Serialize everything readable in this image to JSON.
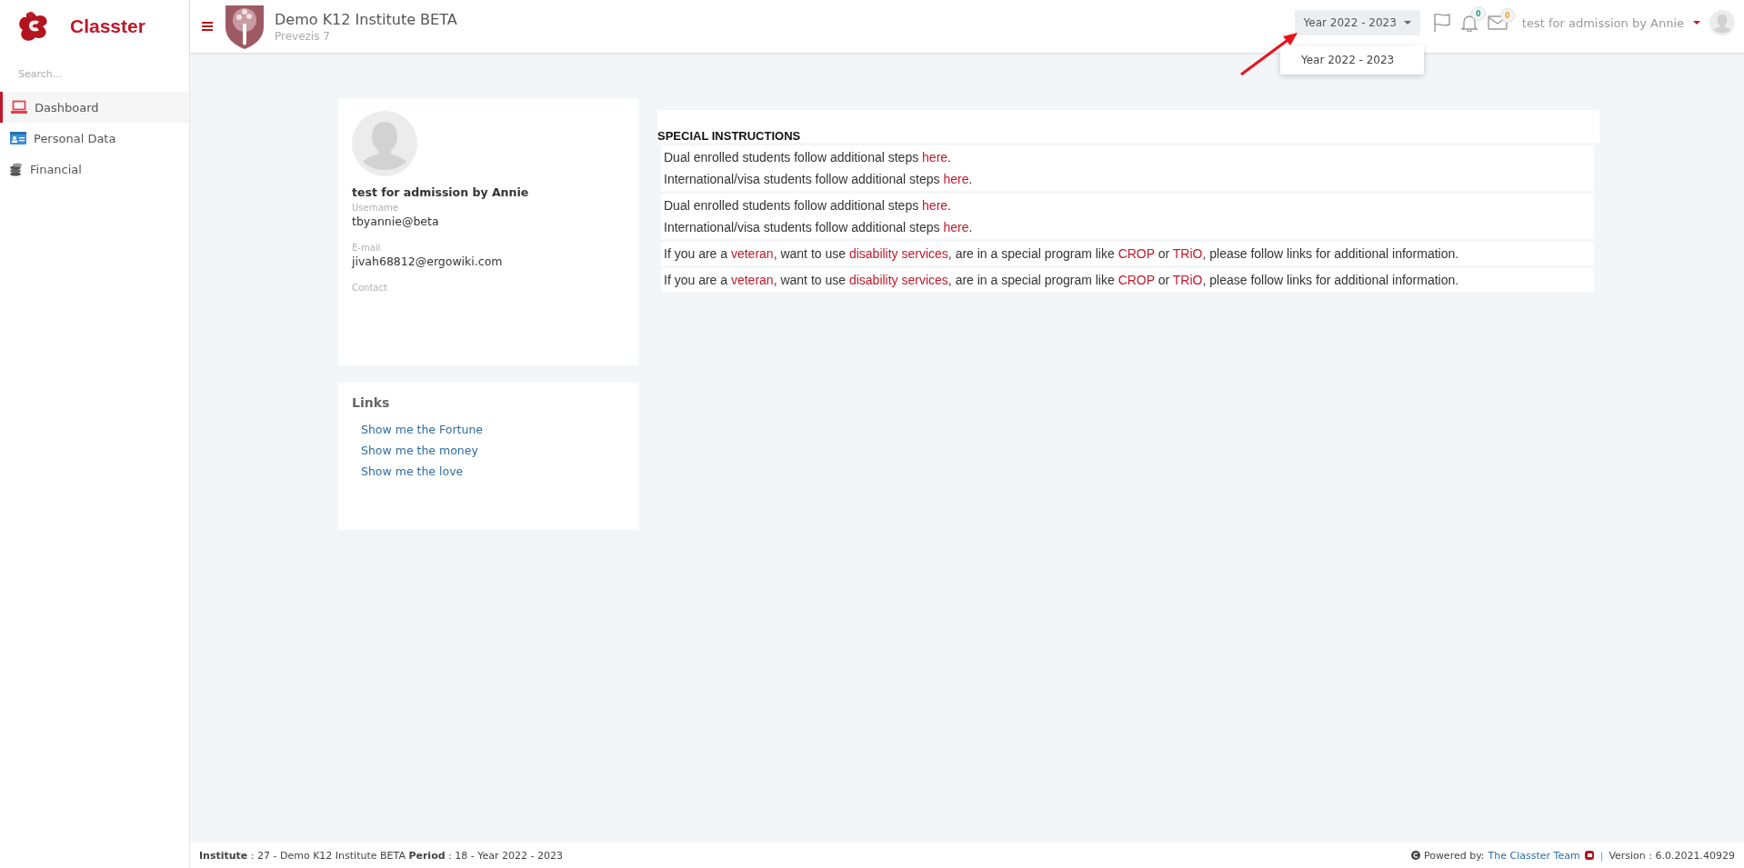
{
  "sidebar": {
    "brand": "Classter",
    "search": {
      "placeholder": "Search..."
    },
    "items": [
      {
        "label": "Dashboard",
        "kind": "laptop",
        "selected": true
      },
      {
        "label": "Personal Data",
        "kind": "card",
        "selected": false
      },
      {
        "label": "Financial",
        "kind": "coins",
        "selected": false
      }
    ]
  },
  "header": {
    "title": "Demo K12 Institute BETA",
    "subtitle": "Prevezis 7",
    "year_button": "Year 2022 - 2023",
    "notifications": [
      {
        "kind": "bell",
        "count": "0",
        "color": "#1aa88a"
      },
      {
        "kind": "mail",
        "count": "0",
        "color": "#f0a030"
      }
    ],
    "user": "test for admission by Annie",
    "year_menu": [
      {
        "label": "Year 2022 - 2023"
      }
    ]
  },
  "profile": {
    "name": "test for admission by Annie",
    "fields": [
      {
        "label": "Username",
        "value": "tbyannie@beta"
      },
      {
        "label": "E-mail",
        "value": "jivah68812@ergowiki.com"
      },
      {
        "label": "Contact"
      }
    ]
  },
  "links": {
    "title": "Links",
    "items": [
      "Show me the Fortune",
      "Show me the money",
      "Show me the love"
    ]
  },
  "instructions": {
    "title": "SPECIAL INSTRUCTIONS",
    "blocks": [
      [
        [
          {
            "kind": "text",
            "text": "Dual enrolled students follow additional steps "
          },
          {
            "kind": "link",
            "text": "here"
          },
          {
            "kind": "text",
            "text": "."
          }
        ],
        [
          {
            "kind": "text",
            "text": "International/visa students follow additional steps "
          },
          {
            "kind": "link",
            "text": "here"
          },
          {
            "kind": "text",
            "text": "."
          }
        ]
      ],
      [
        [
          {
            "kind": "text",
            "text": "Dual enrolled students follow additional steps "
          },
          {
            "kind": "link",
            "text": "here"
          },
          {
            "kind": "text",
            "text": "."
          }
        ],
        [
          {
            "kind": "text",
            "text": "International/visa students follow additional steps "
          },
          {
            "kind": "link",
            "text": "here"
          },
          {
            "kind": "text",
            "text": "."
          }
        ]
      ],
      [
        [
          {
            "kind": "text",
            "text": "If you are a "
          },
          {
            "kind": "link",
            "text": "veteran"
          },
          {
            "kind": "text",
            "text": ", want to use "
          },
          {
            "kind": "link",
            "text": "disability services"
          },
          {
            "kind": "text",
            "text": ", are in a special program like "
          },
          {
            "kind": "link",
            "text": "CROP"
          },
          {
            "kind": "text",
            "text": " or "
          },
          {
            "kind": "link",
            "text": "TRiO"
          },
          {
            "kind": "text",
            "text": ", please follow links for additional information."
          }
        ]
      ],
      [
        [
          {
            "kind": "text",
            "text": "If you are a "
          },
          {
            "kind": "link",
            "text": "veteran"
          },
          {
            "kind": "text",
            "text": ", want to use "
          },
          {
            "kind": "link",
            "text": "disability services"
          },
          {
            "kind": "text",
            "text": ", are in a special program like "
          },
          {
            "kind": "link",
            "text": "CROP"
          },
          {
            "kind": "text",
            "text": " or "
          },
          {
            "kind": "link",
            "text": "TRiO"
          },
          {
            "kind": "text",
            "text": ", please follow links for additional information."
          }
        ]
      ]
    ]
  },
  "footer": {
    "info": "**Institute** : 27 - Demo K12 Institute BETA **Period** : 18 - Year 2022 - 2023",
    "powered": "Powered by:",
    "team": "The Classter Team",
    "separator": "|",
    "version": "Version : 6.0.2021.40929"
  }
}
